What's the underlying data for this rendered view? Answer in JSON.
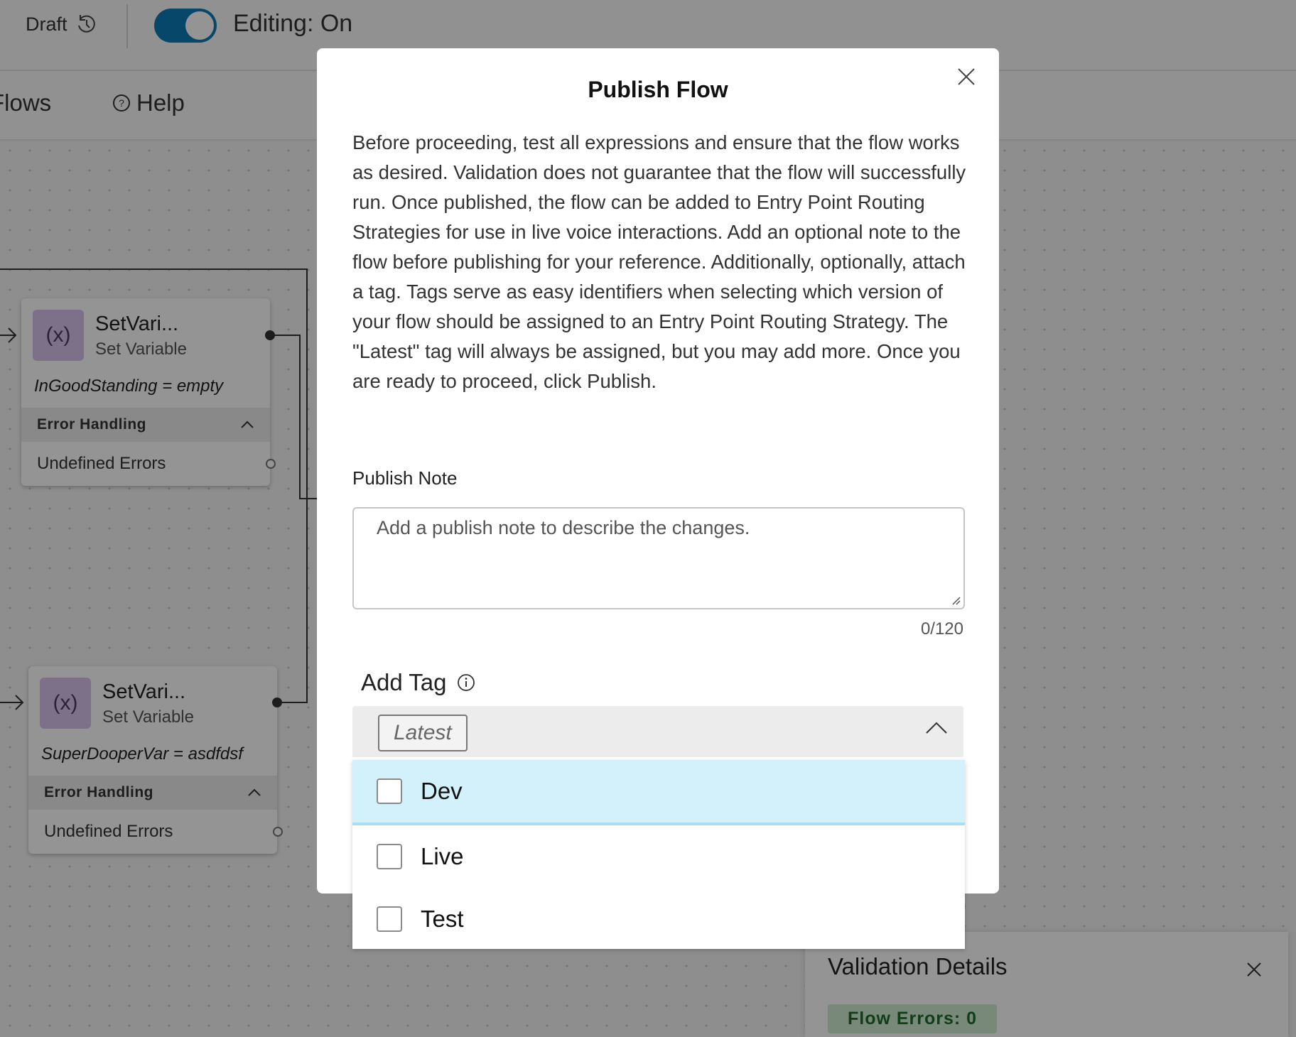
{
  "topbar": {
    "draft_label": "Draft",
    "editing_label": "Editing: On",
    "editing_enabled": true
  },
  "nav": {
    "flows_label": "Flows",
    "help_label": "Help"
  },
  "nodes": [
    {
      "title": "SetVari...",
      "subtitle": "Set Variable",
      "icon_glyph": "(x)",
      "expression": "InGoodStanding = empty",
      "error_handling_label": "Error Handling",
      "undefined_errors_label": "Undefined Errors"
    },
    {
      "title": "SetVari...",
      "subtitle": "Set Variable",
      "icon_glyph": "(x)",
      "expression": "SuperDooperVar = asdfdsf",
      "error_handling_label": "Error Handling",
      "undefined_errors_label": "Undefined Errors"
    }
  ],
  "validation": {
    "title": "Validation Details",
    "badge": "Flow Errors: 0"
  },
  "modal": {
    "title": "Publish Flow",
    "body": "Before proceeding, test all expressions and ensure that the flow works as desired. Validation does not guarantee that the flow will successfully run. Once published, the flow can be added to Entry Point Routing Strategies for use in live voice interactions. Add an optional note to the flow before publishing for your reference. Additionally, optionally, attach a tag. Tags serve as easy identifiers when selecting which version of your flow should be assigned to an Entry Point Routing Strategy. The \"Latest\" tag will always be assigned, but you may add more. Once you are ready to proceed, click Publish.",
    "publish_note_label": "Publish Note",
    "publish_note_value": "",
    "publish_note_placeholder": "Add a publish note to describe the changes.",
    "char_count": "0/120",
    "add_tag_label": "Add Tag",
    "selected_tag": "Latest",
    "tag_options": [
      {
        "label": "Dev",
        "checked": false,
        "highlighted": true
      },
      {
        "label": "Live",
        "checked": false,
        "highlighted": false
      },
      {
        "label": "Test",
        "checked": false,
        "highlighted": false
      }
    ]
  },
  "colors": {
    "accent": "#0d7bb5",
    "highlight": "#d2f1fb",
    "node_icon_bg": "#d7c3ee",
    "success_badge_bg": "#cfead1",
    "success_badge_text": "#1f6a2b"
  }
}
